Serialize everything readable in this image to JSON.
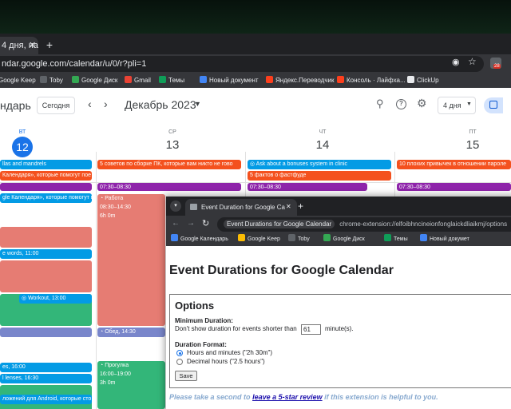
{
  "browser": {
    "tab_title": "4 дня, на",
    "url": "ndar.google.com/calendar/u/0/r?pli=1",
    "ext_badge": "28",
    "bookmarks": [
      {
        "label": "Google Keep",
        "icon": "keep-icon",
        "color": "#fbbc04"
      },
      {
        "label": "Toby",
        "icon": "toby-icon",
        "color": "#5f6368"
      },
      {
        "label": "Google Диск",
        "icon": "drive-icon",
        "color": "#34a853"
      },
      {
        "label": "Gmail",
        "icon": "gmail-icon",
        "color": "#ea4335"
      },
      {
        "label": "Темы",
        "icon": "sheets-icon",
        "color": "#0f9d58"
      },
      {
        "label": "Новый документ",
        "icon": "docs-icon",
        "color": "#4285f4"
      },
      {
        "label": "Яндекс.Переводчик",
        "icon": "translate-icon",
        "color": "#fc3f1d"
      },
      {
        "label": "Консоль · Лайфха...",
        "icon": "console-icon",
        "color": "#fc3f1d"
      },
      {
        "label": "ClickUp",
        "icon": "clickup-icon",
        "color": "#e8eaed"
      }
    ]
  },
  "calendar": {
    "app_name": "ндарь",
    "today_button": "Сегодня",
    "month": "Декабрь 2023",
    "view_button": "4 дня",
    "days": [
      {
        "dow": "ВТ",
        "num": "12",
        "today": true
      },
      {
        "dow": "СР",
        "num": "13",
        "today": false
      },
      {
        "dow": "ЧТ",
        "num": "14",
        "today": false
      },
      {
        "dow": "ПТ",
        "num": "15",
        "today": false
      }
    ],
    "allday": {
      "e1": "llas and mandrels",
      "e2": "Календаря», которые помогут пое",
      "e3": "5 советов по сборке ПК, которые вам никто не гово",
      "e4": "Ask about a bonuses system in clinic",
      "e5": "5 фактов о фастфуде",
      "e6": "10 плохих привычек в отношении пароле"
    },
    "events": {
      "c1_time": "07:30–08:30",
      "c2_time": "07:30–08:30",
      "c3_time": "07:30–08:30",
      "work_title": "Работа",
      "work_time": "08:30–14:30",
      "work_dur": "6h 0m",
      "cal_tip": "gle Календаря», которые помогут п",
      "words": "e words, 11:00",
      "workout": "Workout, 13:00",
      "lunch": "Обед, 14:30",
      "walk_title": "Прогулка",
      "walk_time": "16:00–19:00",
      "walk_dur": "3h 0m",
      "es": "es, 16:00",
      "lenses": "l lenses, 16:30",
      "android": "ложений для Android, которые сто"
    }
  },
  "popup": {
    "tab_title": "Event Duration for Google Ca",
    "url_chip": "Event Durations for Google Calendar",
    "url": "chrome-extension://elfoibhncineionfonglaickdliaikmj/options",
    "bookmarks": [
      {
        "label": "Google Календарь",
        "icon": "calendar-icon",
        "color": "#4285f4"
      },
      {
        "label": "Google Keep",
        "icon": "keep-icon",
        "color": "#fbbc04"
      },
      {
        "label": "Toby",
        "icon": "toby-icon",
        "color": "#5f6368"
      },
      {
        "label": "Google Диск",
        "icon": "drive-icon",
        "color": "#34a853"
      },
      {
        "label": "Темы",
        "icon": "sheets-icon",
        "color": "#0f9d58"
      },
      {
        "label": "Новый докумет",
        "icon": "docs-icon",
        "color": "#4285f4"
      }
    ],
    "title": "Event Durations for Google Calendar",
    "options_heading": "Options",
    "min_duration_label": "Minimum Duration:",
    "min_duration_text_before": "Don't show duration for events shorter than",
    "min_duration_value": "61",
    "min_duration_text_after": "minute(s).",
    "format_label": "Duration Format:",
    "format_options": [
      {
        "label": "Hours and minutes (\"2h 30m\")",
        "checked": true
      },
      {
        "label": "Decimal hours (\"2.5 hours\")",
        "checked": false
      }
    ],
    "save_label": "Save",
    "review_before": "Please take a second to ",
    "review_link": "leave a 5-star review",
    "review_after": " if this extension is helpful to you."
  }
}
